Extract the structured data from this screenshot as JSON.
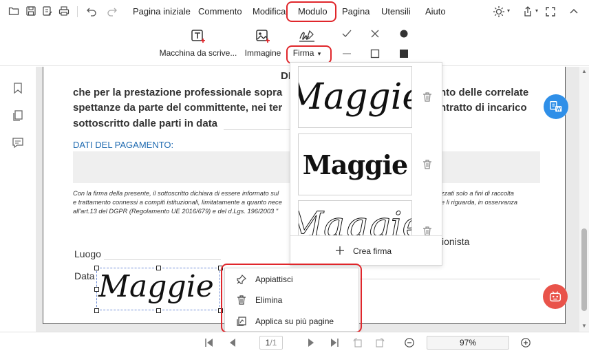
{
  "menubar": {
    "items": [
      "Pagina iniziale",
      "Commento",
      "Modifica",
      "Modulo",
      "Pagina",
      "Utensili",
      "Aiuto"
    ],
    "active": "Modulo"
  },
  "ribbon": {
    "typewriter_label": "Macchina da scrive...",
    "image_label": "Immagine",
    "signature_label": "Firma",
    "signature_dropdown_arrow": "▾"
  },
  "document": {
    "header_fragment": "DI",
    "para_line1": "che per la prestazione professionale sopra",
    "para_line1_right": "nto delle correlate",
    "para_line2": "spettanze da parte del committente, nei ter",
    "para_line2_right": "ntratto di incarico",
    "para_line3": "sottoscritto dalle parti in data",
    "payment_heading": "DATI DEL PAGAMENTO:",
    "privacy_line1_left": "Con la firma della presente, il sottoscritto dichiara di essere informato sul",
    "privacy_line1_right": "zzati solo a fini di raccolta",
    "privacy_line2_left": "e trattamento connessi a compiti istituzionali, limitatamente a quanto nece",
    "privacy_line2_right": "e li riguarda, in osservanza",
    "privacy_line3_left": "all'art.13 del DGPR (Regolamento UE 2016/679) e del d.Lgs. 196/2003 \"",
    "luogo_label": "Luogo",
    "data_label": "Data",
    "professionista_fragment": "sionista",
    "signature_text": "Maggie"
  },
  "signature_panel": {
    "signatures": [
      {
        "text": "Maggie",
        "style": "script-italic"
      },
      {
        "text": "Maggie",
        "style": "bold-block"
      },
      {
        "text": "Maggie",
        "style": "outline-script"
      }
    ],
    "create_label": "Crea firma",
    "create_icon": "plus-icon"
  },
  "context_menu": {
    "items": [
      {
        "label": "Appiattisci",
        "icon": "pin-icon"
      },
      {
        "label": "Elimina",
        "icon": "trash-icon"
      },
      {
        "label": "Applica su più pagine",
        "icon": "apply-pages-icon"
      }
    ]
  },
  "statusbar": {
    "page_value": "1",
    "page_total": "/1",
    "zoom_value": "97%"
  },
  "colors": {
    "highlight_ring": "#e0262b",
    "fab_blue": "#2f8fe8",
    "fab_red": "#e9534a",
    "doc_blue": "#1e6ab0"
  }
}
